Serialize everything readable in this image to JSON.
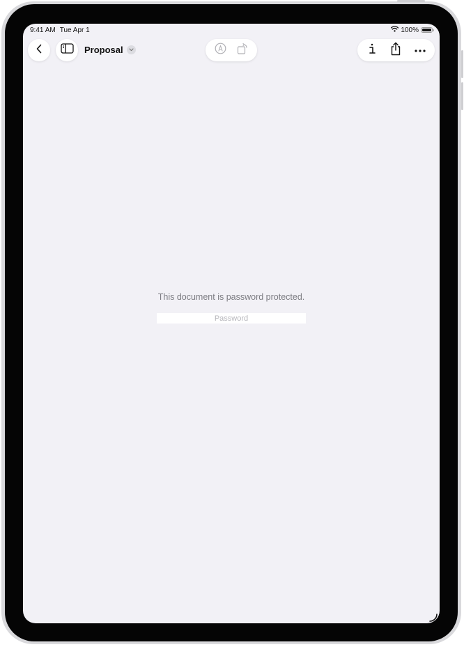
{
  "status_bar": {
    "time": "9:41 AM",
    "date": "Tue Apr 1",
    "battery_percent": "100%"
  },
  "toolbar": {
    "back_icon": "chevron-left-icon",
    "sidebar_icon": "sidebar-icon",
    "document_title": "Proposal",
    "title_menu_icon": "chevron-down-icon",
    "markup_icon": "markup-pen-icon",
    "rotate_icon": "rotate-icon",
    "info_icon": "info-icon",
    "share_icon": "share-icon",
    "more_icon": "ellipsis-icon"
  },
  "content": {
    "message": "This document is password protected.",
    "password_placeholder": "Password",
    "password_value": ""
  },
  "colors": {
    "screen_background": "#f2f1f6",
    "button_background": "#ffffff",
    "disabled_icon": "#b0b0b5",
    "message_text": "#7c7c82"
  }
}
